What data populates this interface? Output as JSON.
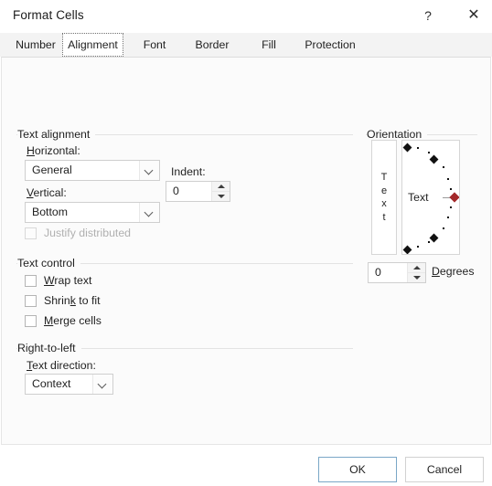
{
  "window": {
    "title": "Format Cells",
    "help_icon": "?",
    "close_icon": "✕"
  },
  "tabs": [
    {
      "label": "Number",
      "selected": false
    },
    {
      "label": "Alignment",
      "selected": true
    },
    {
      "label": "Font",
      "selected": false
    },
    {
      "label": "Border",
      "selected": false
    },
    {
      "label": "Fill",
      "selected": false
    },
    {
      "label": "Protection",
      "selected": false
    }
  ],
  "text_alignment": {
    "group_label": "Text alignment",
    "horizontal": {
      "label_pre": "",
      "label_acc": "H",
      "label_post": "orizontal:",
      "value": "General"
    },
    "vertical": {
      "label_pre": "",
      "label_acc": "V",
      "label_post": "ertical:",
      "value": "Bottom"
    },
    "indent": {
      "label": "Indent:",
      "value": "0"
    },
    "justify_distributed": {
      "label_pre": "Justify distributed",
      "label_acc": "",
      "label_post": "",
      "checked": false,
      "enabled": false
    }
  },
  "text_control": {
    "group_label": "Text control",
    "items": [
      {
        "label_pre": "",
        "label_acc": "W",
        "label_post": "rap text",
        "checked": false
      },
      {
        "label_pre": "Shrin",
        "label_acc": "k",
        "label_post": " to fit",
        "checked": false
      },
      {
        "label_pre": "",
        "label_acc": "M",
        "label_post": "erge cells",
        "checked": false
      }
    ]
  },
  "right_to_left": {
    "group_label": "Right-to-left",
    "text_direction": {
      "label_pre": "",
      "label_acc": "T",
      "label_post": "ext direction:",
      "value": "Context"
    }
  },
  "orientation": {
    "group_label": "Orientation",
    "vertical_text_label": "Text",
    "dial_label": "Text",
    "degrees_value": "0",
    "degrees_label_pre": "",
    "degrees_label_acc": "D",
    "degrees_label_post": "egrees",
    "handle_color": "#a3282a"
  },
  "footer": {
    "ok_label": "OK",
    "cancel_label": "Cancel"
  }
}
